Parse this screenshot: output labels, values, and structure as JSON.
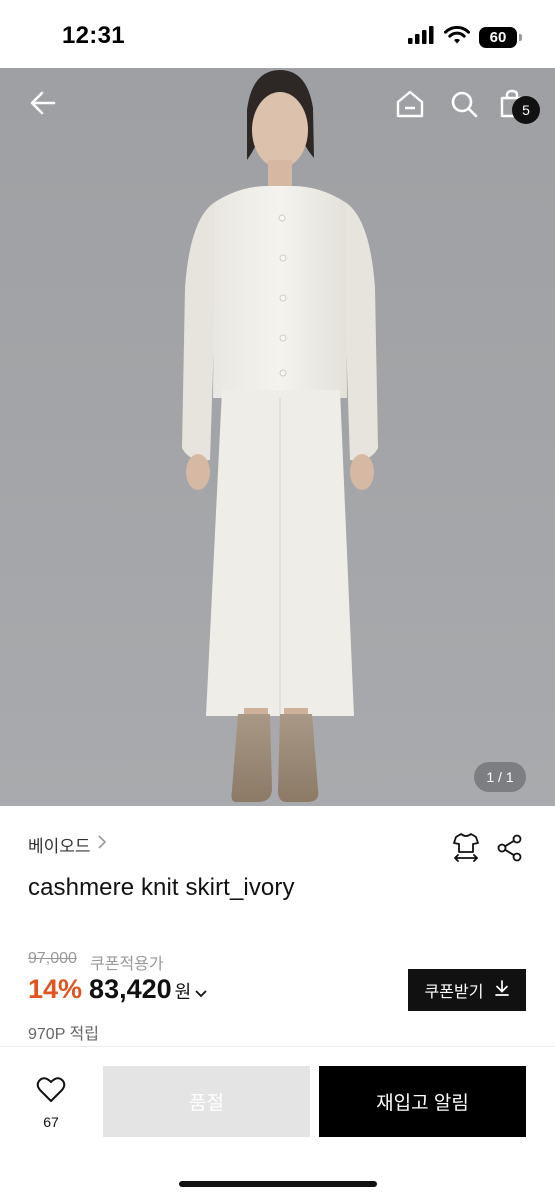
{
  "status_bar": {
    "time": "12:31",
    "battery": "60",
    "icons": [
      "cellular-signal-icon",
      "wifi-icon",
      "battery-icon"
    ]
  },
  "hero": {
    "page_indicator": "1 / 1",
    "cart_badge": "5",
    "icons": [
      "back-arrow-icon",
      "home-icon",
      "search-icon",
      "shopping-bag-icon"
    ]
  },
  "product": {
    "brand": "베이오드",
    "title": "cashmere knit skirt_ivory",
    "original_price": "97,000",
    "coupon_note": "쿠폰적용가",
    "discount": "14%",
    "sale_price": "83,420",
    "currency": "원",
    "coupon_button": "쿠폰받기",
    "points": "970P 적립",
    "icons": [
      "size-guide-icon",
      "share-icon",
      "download-icon",
      "chevron-down-icon"
    ]
  },
  "bottom_bar": {
    "like_count": "67",
    "soldout_label": "품절",
    "restock_label": "재입고 알림"
  },
  "colors": {
    "accent": "#e2531f",
    "black": "#111111",
    "disabled": "#e4e4e4"
  }
}
